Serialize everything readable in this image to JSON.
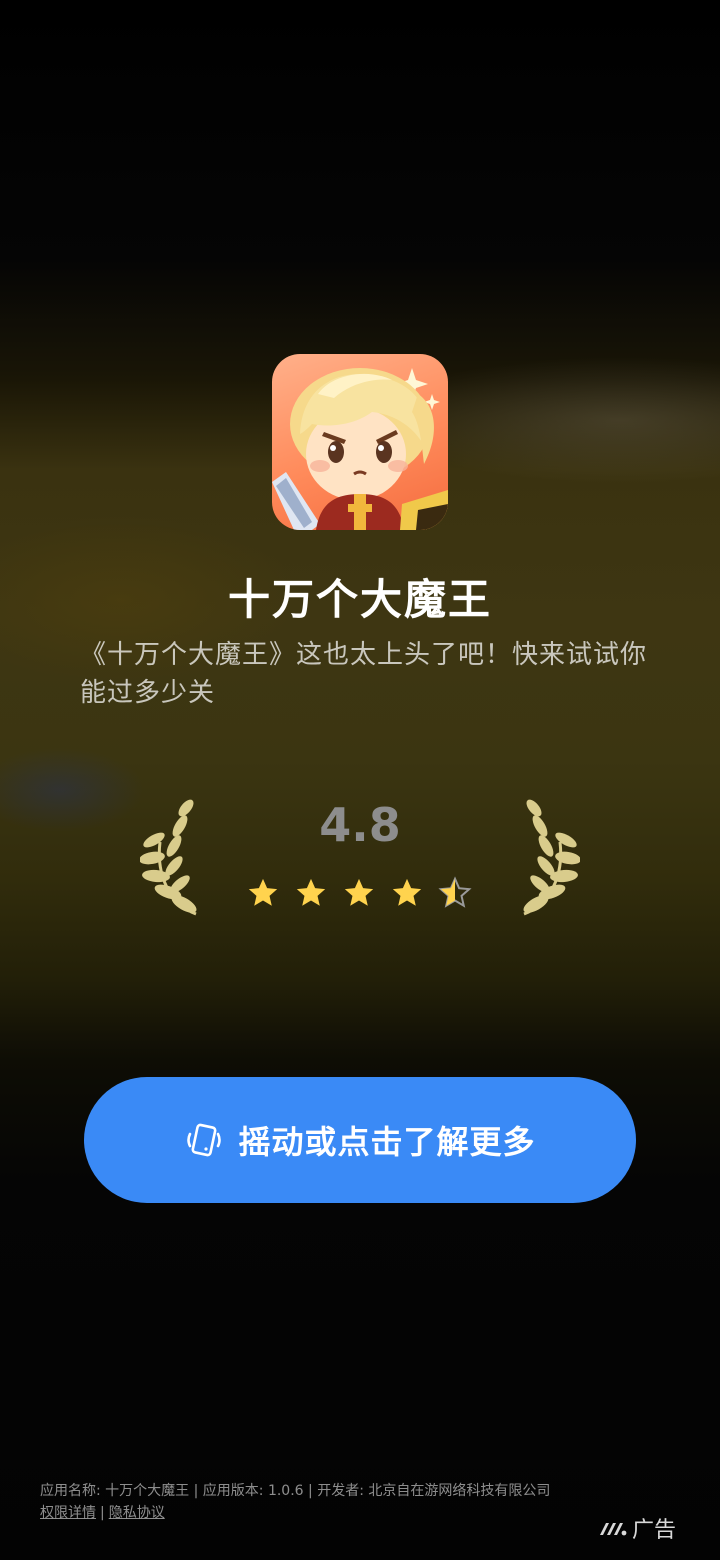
{
  "app": {
    "name": "十万个大魔王",
    "description": "《十万个大魔王》这也太上头了吧！快来试试你能过多少关",
    "icon": "game-character-icon"
  },
  "rating": {
    "score": "4.8",
    "stars_value": 4.5,
    "stars_max": 5,
    "star_color": "#ffd34e",
    "laurel_color": "#d9cc8c"
  },
  "cta": {
    "label": "摇动或点击了解更多",
    "icon": "shake-phone-icon",
    "color": "#3a8af6"
  },
  "footer": {
    "info": "应用名称: 十万个大魔王 | 应用版本: 1.0.6 | 开发者: 北京自在游网络科技有限公司",
    "permissions_link": "权限详情",
    "separator": "|",
    "privacy_link": "隐私协议"
  },
  "ad_badge": {
    "label": "广告",
    "icon": "ad-network-logo-icon"
  }
}
